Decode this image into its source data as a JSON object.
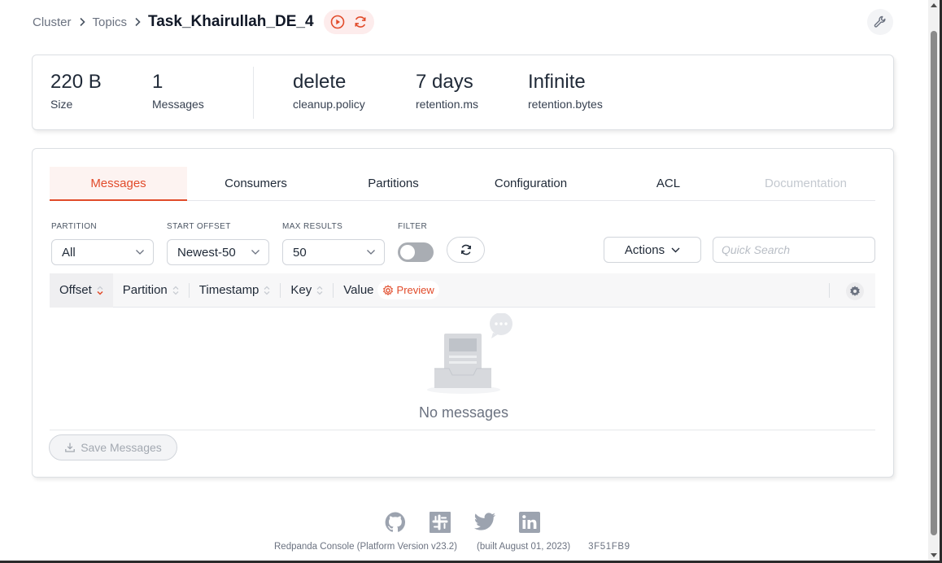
{
  "breadcrumb": {
    "cluster": "Cluster",
    "topics": "Topics",
    "topic_name": "Task_Khairullah_DE_4"
  },
  "stats": [
    {
      "value": "220 B",
      "label": "Size"
    },
    {
      "value": "1",
      "label": "Messages"
    },
    {
      "value": "delete",
      "label": "cleanup.policy"
    },
    {
      "value": "7 days",
      "label": "retention.ms"
    },
    {
      "value": "Infinite",
      "label": "retention.bytes"
    }
  ],
  "tabs": [
    {
      "label": "Messages",
      "state": "active"
    },
    {
      "label": "Consumers",
      "state": "normal"
    },
    {
      "label": "Partitions",
      "state": "normal"
    },
    {
      "label": "Configuration",
      "state": "normal"
    },
    {
      "label": "ACL",
      "state": "normal"
    },
    {
      "label": "Documentation",
      "state": "disabled"
    }
  ],
  "filters": {
    "partition": {
      "label": "PARTITION",
      "value": "All"
    },
    "start_offset": {
      "label": "START OFFSET",
      "value": "Newest-50"
    },
    "max_results": {
      "label": "MAX RESULTS",
      "value": "50"
    },
    "filter": {
      "label": "FILTER",
      "enabled": false
    }
  },
  "actions_label": "Actions",
  "search": {
    "placeholder": "Quick Search",
    "value": ""
  },
  "table": {
    "columns": [
      "Offset",
      "Partition",
      "Timestamp",
      "Key",
      "Value"
    ],
    "sorted_column": "Offset",
    "preview_label": "Preview"
  },
  "empty_text": "No messages",
  "save_label": "Save Messages",
  "footer": {
    "version": "Redpanda Console (Platform Version v23.2)",
    "built": "(built August 01, 2023)",
    "hash": "3F51FB9"
  },
  "colors": {
    "accent": "#e14b2a",
    "muted": "#6b7280",
    "icon": "#9ca3af"
  },
  "icons": {
    "header": [
      "chevron-right-icon",
      "play-circle-icon",
      "refresh-icon",
      "wrench-icon"
    ],
    "footer": [
      "github-icon",
      "slack-icon",
      "twitter-icon",
      "linkedin-icon"
    ]
  }
}
